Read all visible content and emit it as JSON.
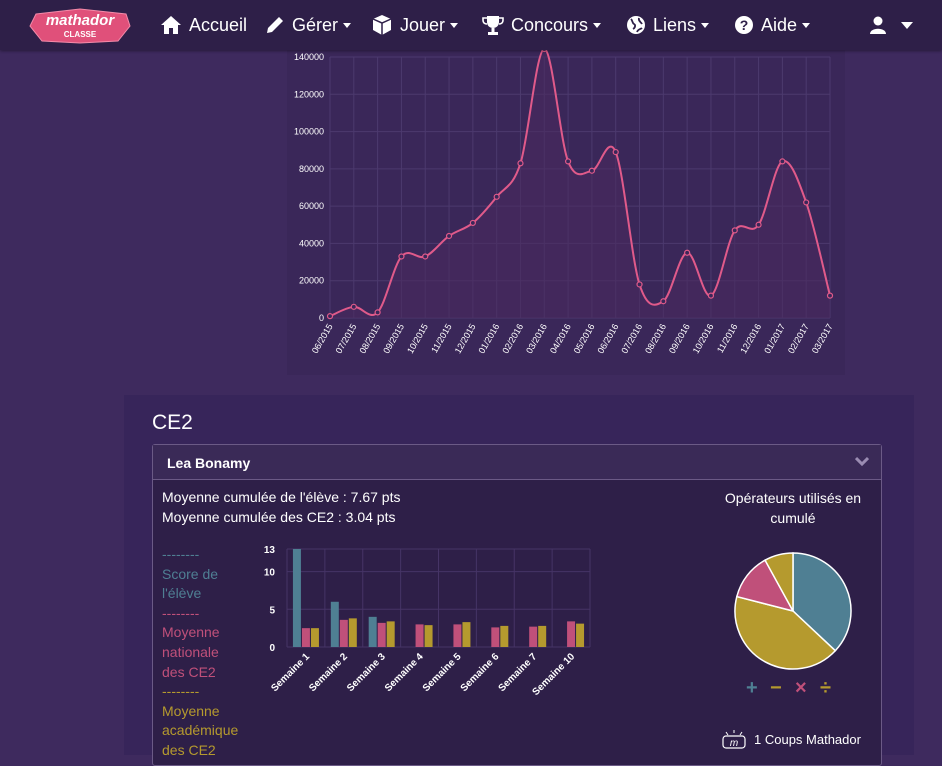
{
  "navbar": {
    "logo_top": "mathador",
    "logo_bottom": "CLASSE",
    "items": [
      {
        "label": "Accueil",
        "caret": false
      },
      {
        "label": "Gérer",
        "caret": true
      },
      {
        "label": "Jouer",
        "caret": true
      },
      {
        "label": "Concours",
        "caret": true
      },
      {
        "label": "Liens",
        "caret": true
      },
      {
        "label": "Aide",
        "caret": true
      }
    ]
  },
  "chart_data": [
    {
      "type": "line",
      "categories": [
        "06/2015",
        "07/2015",
        "08/2015",
        "09/2015",
        "10/2015",
        "11/2015",
        "12/2015",
        "01/2016",
        "02/2016",
        "03/2016",
        "04/2016",
        "05/2016",
        "06/2016",
        "07/2016",
        "08/2016",
        "09/2016",
        "10/2016",
        "11/2016",
        "12/2016",
        "01/2017",
        "02/2017",
        "03/2017"
      ],
      "values": [
        1000,
        6000,
        3000,
        33000,
        33000,
        44000,
        51000,
        65000,
        83000,
        145000,
        84000,
        79000,
        89000,
        18000,
        9000,
        35000,
        12000,
        47000,
        50000,
        84000,
        62000,
        12000
      ],
      "yticks": [
        "0",
        "20000",
        "40000",
        "60000",
        "80000",
        "100000",
        "120000",
        "140000"
      ],
      "ylim": [
        0,
        140000
      ],
      "colors": {
        "line": "#e05a8a"
      }
    },
    {
      "type": "bar",
      "categories": [
        "Semaine 1",
        "Semaine 2",
        "Semaine 3",
        "Semaine 4",
        "Semaine 5",
        "Semaine 6",
        "Semaine 7",
        "Semaine 10"
      ],
      "series": [
        {
          "name": "Score de l'élève",
          "color": "#4f7f93",
          "values": [
            13,
            6,
            4,
            0,
            0,
            0,
            0,
            0
          ]
        },
        {
          "name": "Moyenne nationale des CE2",
          "color": "#c0507a",
          "values": [
            2.5,
            3.6,
            3.2,
            3.0,
            3.0,
            2.6,
            2.7,
            3.4
          ]
        },
        {
          "name": "Moyenne académique des CE2",
          "color": "#b59a2e",
          "values": [
            2.5,
            3.8,
            3.4,
            2.9,
            3.3,
            2.8,
            2.8,
            3.1
          ]
        }
      ],
      "yticks": [
        "0",
        "5",
        "10",
        "13"
      ],
      "ylim": [
        0,
        13
      ]
    },
    {
      "type": "pie",
      "slices": [
        {
          "label": "+",
          "value": 37,
          "color": "#4f7f93"
        },
        {
          "label": "−",
          "value": 42,
          "color": "#b59a2e"
        },
        {
          "label": "×",
          "value": 13,
          "color": "#c0507a"
        },
        {
          "label": "÷",
          "value": 8,
          "color": "#b59a2e"
        }
      ]
    }
  ],
  "class_section": {
    "title": "CE2",
    "student": {
      "name": "Lea Bonamy",
      "avg_student": "Moyenne cumulée de l'élève : 7.67 pts",
      "avg_class": "Moyenne cumulée des CE2 : 3.04 pts",
      "legend": [
        {
          "dashes": "--------",
          "lines": [
            "Score de",
            "l'élève"
          ],
          "color": "#4f7f93"
        },
        {
          "dashes": "--------",
          "lines": [
            "Moyenne",
            "nationale",
            "des CE2"
          ],
          "color": "#c0507a"
        },
        {
          "dashes": "--------",
          "lines": [
            "Moyenne",
            "académique",
            "des CE2"
          ],
          "color": "#b59a2e"
        }
      ],
      "operators_title_line1": "Opérateurs utilisés en",
      "operators_title_line2": "cumulé",
      "operator_symbols": [
        "+",
        "−",
        "×",
        "÷"
      ],
      "operator_colors": [
        "#4f7f93",
        "#b59a2e",
        "#c0507a",
        "#b59a2e"
      ],
      "coups_text": "1 Coups Mathador",
      "coups_icon_text": "m"
    }
  }
}
